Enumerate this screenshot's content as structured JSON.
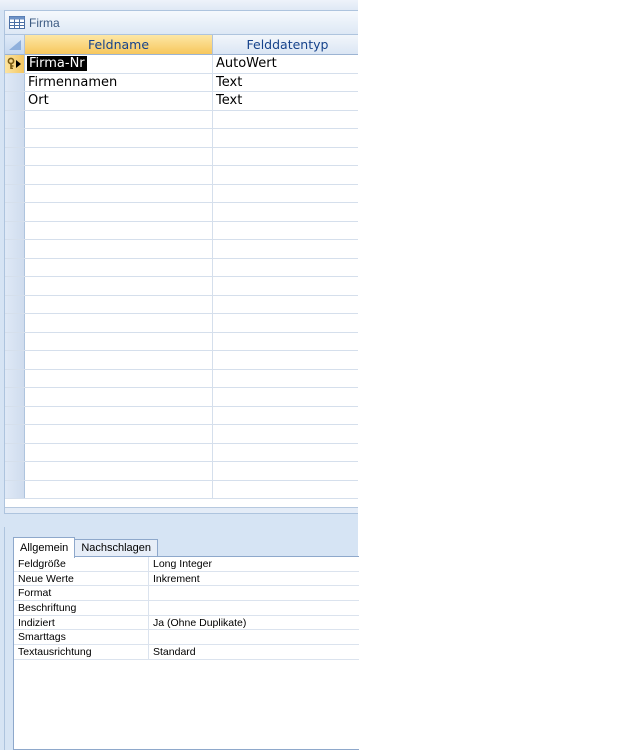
{
  "window": {
    "title": "Firma",
    "icon": "table-icon"
  },
  "grid": {
    "headers": {
      "feldname": "Feldname",
      "felddatentyp": "Felddatentyp"
    },
    "fields": [
      {
        "name": "Firma-Nr",
        "type": "AutoWert",
        "primary_key": true,
        "selected": true
      },
      {
        "name": "Firmennamen",
        "type": "Text"
      },
      {
        "name": "Ort",
        "type": "Text"
      }
    ]
  },
  "properties": {
    "tabs": [
      {
        "label": "Allgemein",
        "active": true
      },
      {
        "label": "Nachschlagen",
        "active": false
      }
    ],
    "rows": [
      {
        "label": "Feldgröße",
        "value": "Long Integer"
      },
      {
        "label": "Neue Werte",
        "value": "Inkrement"
      },
      {
        "label": "Format",
        "value": ""
      },
      {
        "label": "Beschriftung",
        "value": ""
      },
      {
        "label": "Indiziert",
        "value": "Ja (Ohne Duplikate)"
      },
      {
        "label": "Smarttags",
        "value": ""
      },
      {
        "label": "Textausrichtung",
        "value": "Standard"
      }
    ]
  },
  "colors": {
    "accent_header": "#f7c75d",
    "chrome": "#d6e4f4",
    "header_text": "#15428b"
  }
}
